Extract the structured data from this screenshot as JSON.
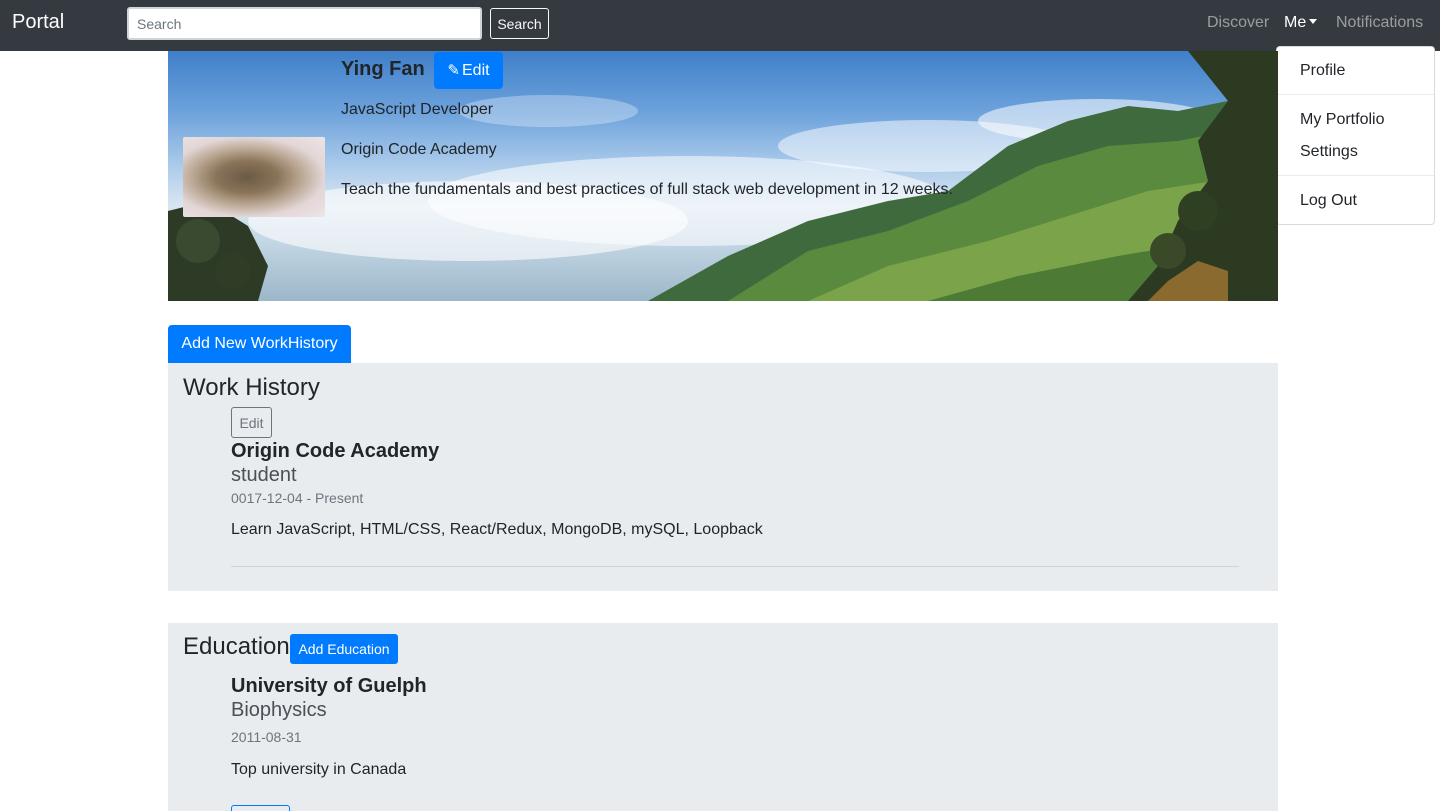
{
  "navbar": {
    "brand": "Portal",
    "search_placeholder": "Search",
    "search_button": "Search",
    "links": {
      "discover": "Discover",
      "me": "Me",
      "notifications": "Notifications"
    }
  },
  "dropdown": {
    "items": [
      "Profile",
      "My Portfolio",
      "Settings",
      "Log Out"
    ]
  },
  "profile": {
    "name": "Ying Fan",
    "edit_label": "Edit",
    "title": "JavaScript Developer",
    "company": "Origin Code Academy",
    "description": "Teach the fundamentals and best practices of full stack web development in 12 weeks."
  },
  "work": {
    "add_button": "Add New WorkHistory",
    "title": "Work History",
    "entries": [
      {
        "edit_label": "Edit",
        "company": "Origin Code Academy",
        "role": "student",
        "dates": "0017-12-04 - Present",
        "description": "Learn JavaScript, HTML/CSS, React/Redux, MongoDB, mySQL, Loopback"
      }
    ]
  },
  "education": {
    "title": "Education",
    "add_button": "Add Education",
    "entries": [
      {
        "school": "University of Guelph",
        "field": "Biophysics",
        "date": "2011-08-31",
        "description": "Top university in Canada"
      }
    ]
  },
  "colors": {
    "navbar": "#343a40",
    "primary": "#007bff",
    "section_bg": "#e9ecef",
    "muted": "#6c757d"
  }
}
